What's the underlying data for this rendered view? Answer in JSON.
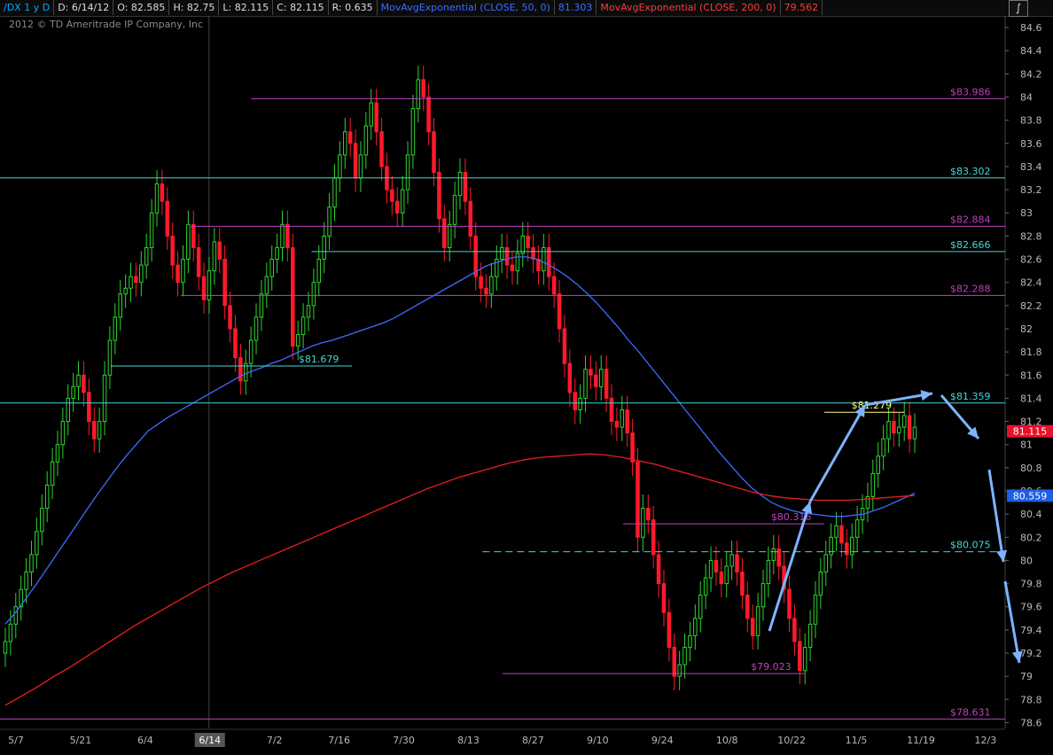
{
  "header": {
    "symbol": "/DX 1 y D",
    "date": "D: 6/14/12",
    "open": "O: 82.585",
    "high": "H: 82.75",
    "low": "L: 82.115",
    "close": "C: 82.115",
    "range": "R: 0.635",
    "ma50_label": "MovAvgExponential (CLOSE, 50, 0)",
    "ma50_value": "81.303",
    "ma200_label": "MovAvgExponential (CLOSE, 200, 0)",
    "ma200_value": "79.562",
    "copyright": "2012 © TD Ameritrade IP Company, Inc",
    "tool_icon": "draw-tool-icon"
  },
  "chart_data": {
    "type": "candlestick",
    "x_tick_labels": [
      "5/7",
      "5/21",
      "6/4",
      "6/14",
      "7/2",
      "7/16",
      "7/30",
      "8/13",
      "8/27",
      "9/10",
      "9/24",
      "10/8",
      "10/22",
      "11/5",
      "11/19",
      "12/3"
    ],
    "highlighted_x_label": "6/14",
    "y_ticks": [
      78.6,
      78.8,
      79,
      79.2,
      79.4,
      79.6,
      79.8,
      80,
      80.2,
      80.4,
      80.6,
      80.8,
      81,
      81.2,
      81.4,
      81.6,
      81.8,
      82,
      82.2,
      82.4,
      82.6,
      82.8,
      83,
      83.2,
      83.4,
      83.6,
      83.8,
      84,
      84.2,
      84.4,
      84.6
    ],
    "y_tick_labels": [
      "78.6",
      "78.8",
      "79",
      "79.2",
      "79.4",
      "79.6",
      "79.8",
      "80",
      "80.2",
      "80.4",
      "80.6",
      "80.8",
      "81",
      "81.2",
      "81.4",
      "81.6",
      "81.8",
      "82",
      "82.2",
      "82.4",
      "82.6",
      "82.8",
      "83",
      "83.2",
      "83.4",
      "83.6",
      "83.8",
      "84",
      "84.2",
      "84.4",
      "84.6"
    ],
    "ylim": [
      78.55,
      84.7
    ],
    "price_badges": [
      {
        "value": 81.115,
        "label": "81.115",
        "color": "#e8102a"
      },
      {
        "value": 80.559,
        "label": "80.559",
        "color": "#1e5ee6"
      }
    ],
    "closes": [
      79.3,
      79.45,
      79.6,
      79.75,
      79.9,
      80.05,
      80.25,
      80.45,
      80.65,
      80.85,
      81.0,
      81.2,
      81.4,
      81.5,
      81.6,
      81.45,
      81.2,
      81.05,
      81.2,
      81.6,
      81.9,
      82.1,
      82.3,
      82.35,
      82.45,
      82.4,
      82.55,
      82.7,
      83.0,
      83.25,
      83.1,
      82.8,
      82.55,
      82.4,
      82.6,
      82.9,
      82.7,
      82.45,
      82.25,
      82.5,
      82.75,
      82.6,
      82.2,
      82.0,
      81.75,
      81.55,
      81.7,
      81.9,
      82.1,
      82.3,
      82.45,
      82.6,
      82.7,
      82.9,
      82.7,
      81.85,
      81.95,
      82.1,
      82.2,
      82.4,
      82.6,
      82.8,
      83.05,
      83.3,
      83.5,
      83.7,
      83.6,
      83.3,
      83.5,
      83.75,
      83.95,
      83.7,
      83.4,
      83.2,
      83.1,
      83.0,
      83.2,
      83.5,
      83.9,
      84.15,
      84.0,
      83.7,
      83.35,
      82.95,
      82.7,
      82.9,
      83.15,
      83.35,
      83.1,
      82.8,
      82.45,
      82.35,
      82.3,
      82.45,
      82.6,
      82.7,
      82.55,
      82.5,
      82.65,
      82.8,
      82.7,
      82.6,
      82.5,
      82.7,
      82.45,
      82.3,
      82.0,
      81.7,
      81.45,
      81.3,
      81.4,
      81.65,
      81.6,
      81.5,
      81.65,
      81.4,
      81.2,
      81.15,
      81.3,
      81.1,
      80.85,
      80.2,
      80.45,
      80.35,
      80.05,
      79.8,
      79.55,
      79.25,
      79.0,
      79.1,
      79.25,
      79.35,
      79.5,
      79.7,
      79.85,
      80.0,
      79.9,
      79.8,
      79.95,
      80.05,
      79.9,
      79.7,
      79.5,
      79.35,
      79.6,
      79.8,
      80.0,
      80.1,
      79.95,
      79.75,
      79.5,
      79.3,
      79.05,
      79.25,
      79.45,
      79.7,
      79.9,
      80.05,
      80.2,
      80.3,
      80.15,
      80.05,
      80.2,
      80.35,
      80.45,
      80.55,
      80.75,
      80.9,
      81.05,
      81.2,
      81.1,
      81.15,
      81.25,
      81.05,
      81.15
    ],
    "ema50": [
      79.45,
      79.55,
      79.67,
      79.79,
      79.92,
      80.05,
      80.18,
      80.31,
      80.44,
      80.57,
      80.69,
      80.81,
      80.92,
      81.02,
      81.12,
      81.18,
      81.24,
      81.29,
      81.34,
      81.39,
      81.44,
      81.49,
      81.54,
      81.59,
      81.63,
      81.66,
      81.7,
      81.73,
      81.77,
      81.81,
      81.85,
      81.88,
      81.9,
      81.93,
      81.96,
      81.99,
      82.02,
      82.05,
      82.09,
      82.14,
      82.19,
      82.24,
      82.29,
      82.34,
      82.39,
      82.44,
      82.49,
      82.54,
      82.57,
      82.6,
      82.62,
      82.62,
      82.6,
      82.56,
      82.51,
      82.45,
      82.38,
      82.3,
      82.21,
      82.11,
      82.01,
      81.9,
      81.8,
      81.69,
      81.58,
      81.47,
      81.36,
      81.25,
      81.14,
      81.03,
      80.92,
      80.82,
      80.72,
      80.63,
      80.56,
      80.5,
      80.46,
      80.43,
      80.41,
      80.4,
      80.39,
      80.38,
      80.38,
      80.39,
      80.4,
      80.43,
      80.46,
      80.5,
      80.54,
      80.58
    ],
    "ema200": [
      78.75,
      78.83,
      78.91,
      79.0,
      79.08,
      79.17,
      79.26,
      79.35,
      79.44,
      79.52,
      79.6,
      79.68,
      79.76,
      79.83,
      79.9,
      79.96,
      80.02,
      80.08,
      80.14,
      80.2,
      80.26,
      80.32,
      80.38,
      80.44,
      80.5,
      80.56,
      80.62,
      80.67,
      80.72,
      80.76,
      80.8,
      80.84,
      80.87,
      80.89,
      80.9,
      80.91,
      80.92,
      80.91,
      80.89,
      80.86,
      80.83,
      80.79,
      80.75,
      80.71,
      80.67,
      80.63,
      80.59,
      80.56,
      80.54,
      80.53,
      80.52,
      80.52,
      80.52,
      80.53,
      80.54,
      80.55,
      80.56
    ],
    "levels": [
      {
        "value": 83.986,
        "label": "$83.986",
        "color": "#c040c0",
        "x0": 0.25,
        "x1": 1.0,
        "dashed": false
      },
      {
        "value": 83.302,
        "label": "$83.302",
        "color": "#40d8d8",
        "x0": 0.0,
        "x1": 1.0,
        "dashed": false
      },
      {
        "value": 82.884,
        "label": "$82.884",
        "color": "#c040c0",
        "x0": 0.19,
        "x1": 1.0,
        "dashed": false
      },
      {
        "value": 82.666,
        "label": "$82.666",
        "color": "#40d8d8",
        "x0": 0.31,
        "x1": 1.0,
        "dashed": false
      },
      {
        "value": 82.288,
        "label": "$82.288",
        "color": "#c040c0",
        "x0": 0.18,
        "x1": 1.0,
        "dashed": false
      },
      {
        "value": 81.679,
        "label": "$81.679",
        "color": "#40d8d8",
        "x0": 0.11,
        "x1": 0.35,
        "dashed": false
      },
      {
        "value": 81.359,
        "label": "$81.359",
        "color": "#40d8d8",
        "x0": 0.0,
        "x1": 1.0,
        "dashed": false
      },
      {
        "value": 81.279,
        "label": "$81.279",
        "color": "#ffff80",
        "x0": 0.82,
        "x1": 0.9,
        "dashed": false
      },
      {
        "value": 80.316,
        "label": "$80.316",
        "color": "#c040c0",
        "x0": 0.62,
        "x1": 0.82,
        "dashed": false
      },
      {
        "value": 80.075,
        "label": "$80.075",
        "color": "#40d8d8",
        "x0": 0.48,
        "x1": 1.0,
        "dashed": true
      },
      {
        "value": 79.023,
        "label": "$79.023",
        "color": "#c040c0",
        "x0": 0.5,
        "x1": 0.8,
        "dashed": false
      },
      {
        "value": 78.631,
        "label": "$78.631",
        "color": "#c040c0",
        "x0": 0.0,
        "x1": 1.0,
        "dashed": false
      }
    ],
    "grid": true
  }
}
